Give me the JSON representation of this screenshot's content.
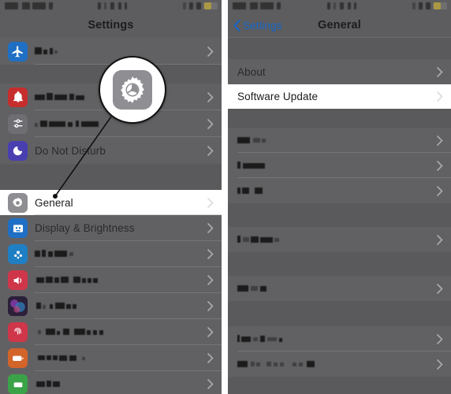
{
  "meta": {
    "description": "Two iOS Settings screenshots side by side with a magnified gear callout",
    "accent_blue": "#1565c8",
    "dim_background": "#5a5a5c",
    "row_background": "#616163",
    "highlight_background": "#ffffff"
  },
  "left_panel": {
    "status_bar": {
      "redacted": true
    },
    "nav": {
      "title": "Settings"
    },
    "rows": [
      {
        "label": "",
        "redacted": true,
        "icon": "airplane-mode-icon",
        "icon_color": "#1f6fc4",
        "highlight": false
      },
      {
        "label": "",
        "redacted": true,
        "icon": "notifications-icon",
        "icon_color": "#c62d2d",
        "highlight": false
      },
      {
        "label": "",
        "redacted": true,
        "icon": "control-center-icon",
        "icon_color": "#6e6e73",
        "highlight": false
      },
      {
        "label": "Do Not Disturb",
        "redacted": false,
        "icon": "do-not-disturb-icon",
        "icon_color": "#4a3fb0",
        "highlight": false
      },
      {
        "label": "General",
        "redacted": false,
        "icon": "general-gear-icon",
        "icon_color": "#8e8e93",
        "highlight": true
      },
      {
        "label": "Display & Brightness",
        "redacted": false,
        "icon": "display-brightness-icon",
        "icon_color": "#1f6fc4",
        "highlight": false
      },
      {
        "label": "",
        "redacted": true,
        "icon": "wallpaper-icon",
        "icon_color": "#1f7fc4",
        "highlight": false
      },
      {
        "label": "",
        "redacted": true,
        "icon": "sounds-icon",
        "icon_color": "#d0364a",
        "highlight": false
      },
      {
        "label": "",
        "redacted": true,
        "icon": "siri-icon",
        "icon_color": "#2b1f3a",
        "highlight": false
      },
      {
        "label": "",
        "redacted": true,
        "icon": "touch-id-passcode-icon",
        "icon_color": "#d0364a",
        "highlight": false
      },
      {
        "label": "",
        "redacted": true,
        "icon": "battery-icon",
        "icon_color": "#d3642a",
        "highlight": false
      },
      {
        "label": "",
        "redacted": true,
        "icon": "privacy-icon",
        "icon_color": "#3aa347",
        "highlight": false
      }
    ]
  },
  "right_panel": {
    "status_bar": {
      "redacted": true
    },
    "nav": {
      "back_label": "Settings",
      "title": "General",
      "back_icon": "chevron-left-icon"
    },
    "rows": [
      {
        "label": "About",
        "redacted": false,
        "highlight": false
      },
      {
        "label": "Software Update",
        "redacted": false,
        "highlight": true
      },
      {
        "label": "",
        "redacted": true,
        "highlight": false
      },
      {
        "label": "",
        "redacted": true,
        "highlight": false
      },
      {
        "label": "",
        "redacted": true,
        "highlight": false
      },
      {
        "label": "",
        "redacted": true,
        "highlight": false
      },
      {
        "label": "",
        "redacted": true,
        "highlight": false
      },
      {
        "label": "",
        "redacted": true,
        "highlight": false
      },
      {
        "label": "",
        "redacted": true,
        "highlight": false
      }
    ]
  },
  "callout": {
    "icon_name": "settings-gear-icon",
    "icon_background": "#8e8e93",
    "target": "General row gear icon"
  }
}
